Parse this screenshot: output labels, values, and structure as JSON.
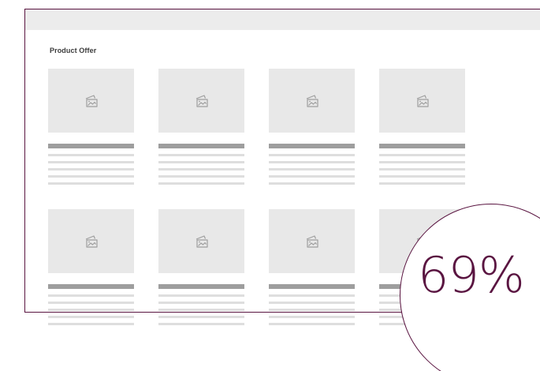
{
  "section": {
    "title": "Product Offer"
  },
  "products": [
    {
      "image_icon": "image-placeholder-icon"
    },
    {
      "image_icon": "image-placeholder-icon"
    },
    {
      "image_icon": "image-placeholder-icon"
    },
    {
      "image_icon": "image-placeholder-icon"
    },
    {
      "image_icon": "image-placeholder-icon"
    },
    {
      "image_icon": "image-placeholder-icon"
    },
    {
      "image_icon": "image-placeholder-icon"
    },
    {
      "image_icon": "image-placeholder-icon"
    }
  ],
  "progress": {
    "label": "69%",
    "value": 0.69
  },
  "colors": {
    "accent": "#5a1541",
    "placeholder": "#e8e8e8",
    "title_bar": "#9e9e9e",
    "text_line": "#dedede",
    "top_bar": "#ececec"
  }
}
